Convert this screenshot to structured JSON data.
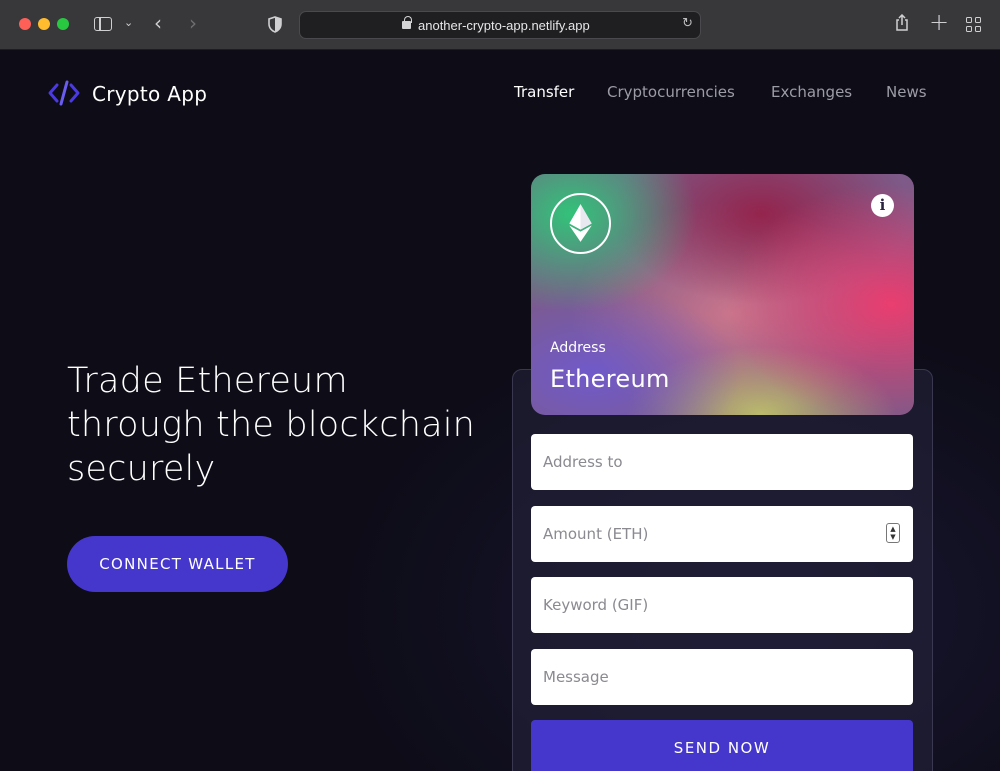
{
  "browser": {
    "url": "another-crypto-app.netlify.app",
    "icons": [
      "sidebar-icon",
      "chevron-down-icon",
      "back-icon",
      "forward-icon",
      "shield-icon",
      "lock-icon",
      "reload-icon",
      "share-icon",
      "plus-icon",
      "tab-grid-icon"
    ]
  },
  "header": {
    "logo_text": "Crypto App",
    "nav": [
      "Transfer",
      "Cryptocurrencies",
      "Exchanges",
      "News"
    ],
    "active_nav": "Transfer"
  },
  "hero": {
    "title": "Trade Ethereum through the blockchain securely",
    "connect_label": "CONNECT WALLET"
  },
  "card": {
    "label": "Address",
    "value": "Ethereum",
    "icons": [
      "ethereum-icon",
      "info-icon"
    ]
  },
  "form": {
    "address_placeholder": "Address to",
    "amount_placeholder": "Amount (ETH)",
    "keyword_placeholder": "Keyword (GIF)",
    "message_placeholder": "Message",
    "send_label": "SEND NOW"
  },
  "colors": {
    "accent": "#4536cc",
    "background": "#0d0c17",
    "nav_inactive": "#9c9ca6"
  }
}
